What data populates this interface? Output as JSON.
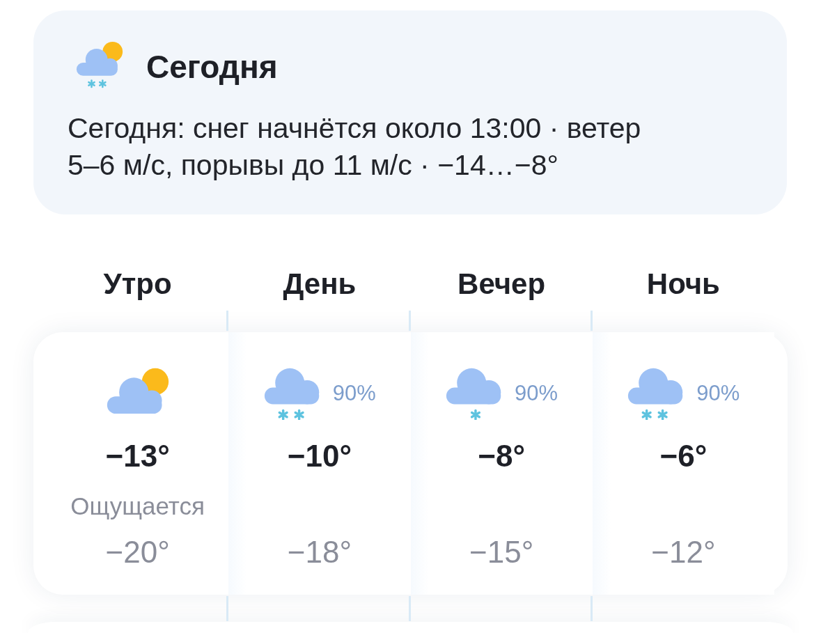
{
  "today": {
    "icon": {
      "kind": "partly-cloudy-snow"
    },
    "title": "Сегодня",
    "summary": "Сегодня: снег начнётся около 13:00 · ветер 5–6 м/с, порывы до 11 м/с · −14…−8°"
  },
  "periods": [
    {
      "name": "Утро",
      "icon": {
        "kind": "partly-cloudy"
      },
      "temperature": "−13°",
      "feels_like_label": "Ощущается",
      "feels_like": "−20°"
    },
    {
      "name": "День",
      "icon": {
        "kind": "snow"
      },
      "precipitation": "90%",
      "temperature": "−10°",
      "feels_like": "−18°"
    },
    {
      "name": "Вечер",
      "icon": {
        "kind": "light-snow"
      },
      "precipitation": "90%",
      "temperature": "−8°",
      "feels_like": "−15°"
    },
    {
      "name": "Ночь",
      "icon": {
        "kind": "snow"
      },
      "precipitation": "90%",
      "temperature": "−6°",
      "feels_like": "−12°"
    }
  ]
}
